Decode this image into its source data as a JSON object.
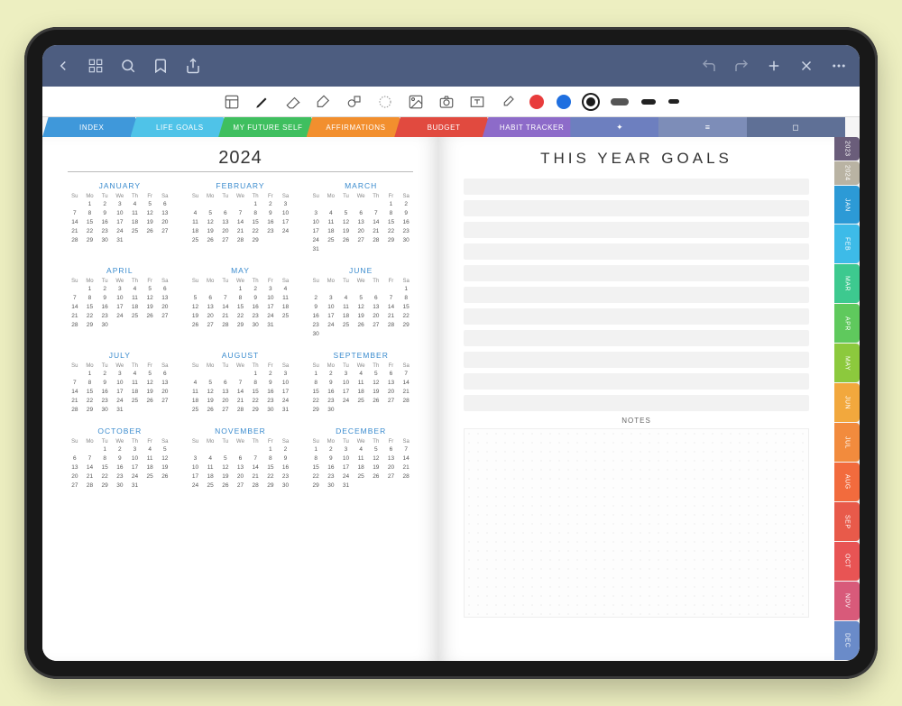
{
  "year": "2024",
  "goals_title": "THIS YEAR GOALS",
  "notes_label": "NOTES",
  "daynames": [
    "Su",
    "Mo",
    "Tu",
    "We",
    "Th",
    "Fr",
    "Sa"
  ],
  "months": [
    {
      "name": "JANUARY",
      "start": 1,
      "days": 31
    },
    {
      "name": "FEBRUARY",
      "start": 4,
      "days": 29
    },
    {
      "name": "MARCH",
      "start": 5,
      "days": 31
    },
    {
      "name": "APRIL",
      "start": 1,
      "days": 30
    },
    {
      "name": "MAY",
      "start": 3,
      "days": 31
    },
    {
      "name": "JUNE",
      "start": 6,
      "days": 30
    },
    {
      "name": "JULY",
      "start": 1,
      "days": 31
    },
    {
      "name": "AUGUST",
      "start": 4,
      "days": 31
    },
    {
      "name": "SEPTEMBER",
      "start": 0,
      "days": 30
    },
    {
      "name": "OCTOBER",
      "start": 2,
      "days": 31
    },
    {
      "name": "NOVEMBER",
      "start": 5,
      "days": 30
    },
    {
      "name": "DECEMBER",
      "start": 0,
      "days": 31
    }
  ],
  "top_tabs": [
    {
      "label": "INDEX",
      "color": "#3f98da"
    },
    {
      "label": "LIFE GOALS",
      "color": "#4fc3e8"
    },
    {
      "label": "MY FUTURE SELF",
      "color": "#3fbf5f"
    },
    {
      "label": "AFFIRMATIONS",
      "color": "#f28f2e"
    },
    {
      "label": "BUDGET",
      "color": "#e14a3f"
    },
    {
      "label": "HABIT TRACKER",
      "color": "#8d6bc9"
    }
  ],
  "mini_tabs": [
    {
      "glyph": "✦",
      "color": "#6d7fbf"
    },
    {
      "glyph": "≡",
      "color": "#7d8db8"
    },
    {
      "glyph": "◻",
      "color": "#5f7096"
    }
  ],
  "year_toggle": [
    {
      "label": "2023",
      "color": "#6a5d7a"
    },
    {
      "label": "2024",
      "color": "#b9b3a3"
    }
  ],
  "side_tabs": [
    {
      "label": "JAN",
      "color": "#2c9ad6"
    },
    {
      "label": "FEB",
      "color": "#3dbbe8"
    },
    {
      "label": "MAR",
      "color": "#3dc98f"
    },
    {
      "label": "APR",
      "color": "#5fc95d"
    },
    {
      "label": "MAY",
      "color": "#8cc93d"
    },
    {
      "label": "JUN",
      "color": "#f2a83d"
    },
    {
      "label": "JUL",
      "color": "#f28b3d"
    },
    {
      "label": "AUG",
      "color": "#f26b3d"
    },
    {
      "label": "SEP",
      "color": "#e85a4a"
    },
    {
      "label": "OCT",
      "color": "#e85454"
    },
    {
      "label": "NOV",
      "color": "#d85a7a"
    },
    {
      "label": "DEC",
      "color": "#6a8bc9"
    }
  ],
  "tools": [
    "template",
    "pen",
    "eraser",
    "highlighter",
    "shapes",
    "lasso",
    "image",
    "camera",
    "text",
    "eyedropper"
  ],
  "colors": {
    "red": "#e83c3c",
    "blue": "#1f6fe0",
    "black": "#111"
  }
}
